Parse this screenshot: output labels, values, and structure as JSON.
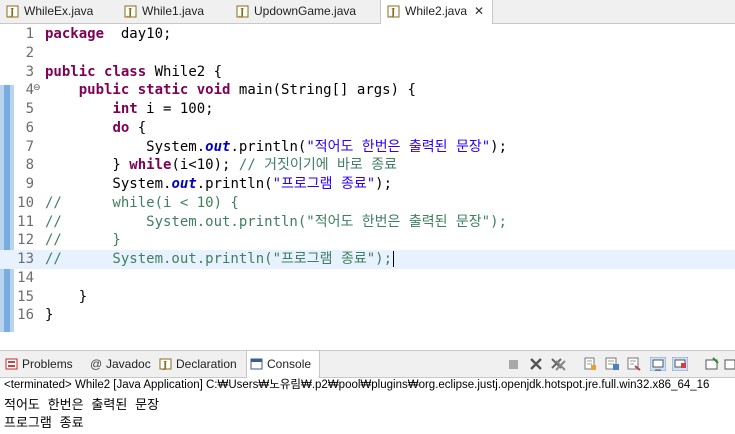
{
  "editor_tabs": [
    {
      "label": "WhileEx.java",
      "active": false
    },
    {
      "label": "While1.java",
      "active": false
    },
    {
      "label": "UpdownGame.java",
      "active": false
    },
    {
      "label": "While2.java",
      "active": true
    }
  ],
  "close_glyph": "✕",
  "code_lines": [
    {
      "n": "1",
      "t": [
        [
          "kw",
          "package"
        ],
        [
          "",
          "  day10;"
        ]
      ]
    },
    {
      "n": "2",
      "t": []
    },
    {
      "n": "3",
      "t": [
        [
          "kw",
          "public"
        ],
        [
          "",
          " "
        ],
        [
          "kw",
          "class"
        ],
        [
          "",
          " While2 {"
        ]
      ]
    },
    {
      "n": "4",
      "t": [
        [
          "",
          "    "
        ],
        [
          "kw",
          "public"
        ],
        [
          "",
          " "
        ],
        [
          "kw",
          "static"
        ],
        [
          "",
          " "
        ],
        [
          "kw",
          "void"
        ],
        [
          "",
          " main(String[] args) {"
        ]
      ]
    },
    {
      "n": "5",
      "t": [
        [
          "",
          "        "
        ],
        [
          "kw",
          "int"
        ],
        [
          "",
          " i = 100;"
        ]
      ]
    },
    {
      "n": "6",
      "t": [
        [
          "",
          "        "
        ],
        [
          "kw",
          "do"
        ],
        [
          "",
          " {"
        ]
      ]
    },
    {
      "n": "7",
      "t": [
        [
          "",
          "            System."
        ],
        [
          "fld",
          "out"
        ],
        [
          "",
          ".println("
        ],
        [
          "str",
          "\"적어도 한번은 출력된 문장\""
        ],
        [
          "",
          ");"
        ]
      ]
    },
    {
      "n": "8",
      "t": [
        [
          "",
          "        } "
        ],
        [
          "kw",
          "while"
        ],
        [
          "",
          "(i<10); "
        ],
        [
          "cm",
          "// 거짓이기에 바로 종료"
        ]
      ]
    },
    {
      "n": "9",
      "t": [
        [
          "",
          "        System."
        ],
        [
          "fld",
          "out"
        ],
        [
          "",
          ".println("
        ],
        [
          "str",
          "\"프로그램 종료\""
        ],
        [
          "",
          ");"
        ]
      ]
    },
    {
      "n": "10",
      "t": [
        [
          "cm",
          "//      while(i < 10) {"
        ]
      ]
    },
    {
      "n": "11",
      "t": [
        [
          "cm",
          "//          System.out.println(\"적어도 한번은 출력된 문장\");"
        ]
      ]
    },
    {
      "n": "12",
      "t": [
        [
          "cm",
          "//      }"
        ]
      ]
    },
    {
      "n": "13",
      "t": [
        [
          "cm",
          "//      System.out.println(\"프로그램 종료\");"
        ]
      ]
    },
    {
      "n": "14",
      "t": []
    },
    {
      "n": "15",
      "t": [
        [
          "",
          "    }"
        ]
      ]
    },
    {
      "n": "16",
      "t": [
        [
          "",
          "}"
        ]
      ]
    }
  ],
  "current_line": "13",
  "fold_glyph": "⊖",
  "console_tabs": [
    {
      "label": "Problems",
      "icon": "problems-icon"
    },
    {
      "label": "Javadoc",
      "icon": "javadoc-icon"
    },
    {
      "label": "Declaration",
      "icon": "declaration-icon"
    },
    {
      "label": "Console",
      "icon": "console-icon",
      "active": true
    }
  ],
  "javadoc_glyph": "@",
  "status_line": "<terminated> While2 [Java Application] C:₩Users₩노유림₩.p2₩pool₩plugins₩org.eclipse.justj.openjdk.hotspot.jre.full.win32.x86_64_16",
  "console_output": [
    "적어도 한번은 출력된 문장",
    "프로그램 종료"
  ],
  "colors": {
    "keyword": "#7f0055",
    "string": "#2a00ff",
    "comment": "#3f7f5f",
    "field": "#0000c0",
    "current_line": "#e8f2fe"
  }
}
